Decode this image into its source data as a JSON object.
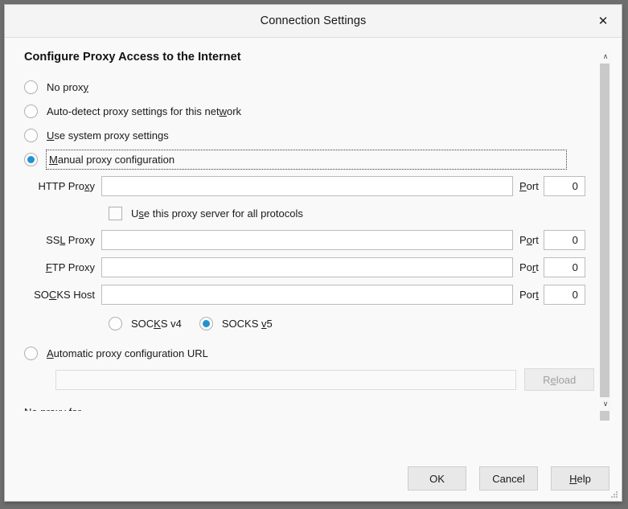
{
  "window": {
    "title": "Connection Settings",
    "close_icon": "close-icon",
    "close_glyph": "✕"
  },
  "section": {
    "title": "Configure Proxy Access to the Internet"
  },
  "proxy_mode": {
    "selected": "manual",
    "options": [
      {
        "id": "no-proxy",
        "label": "No prox",
        "accesskey": "y",
        "label_tail": "",
        "checked": false
      },
      {
        "id": "auto-detect",
        "label": "Auto-detect proxy settings for this net",
        "accesskey": "w",
        "label_tail": "ork",
        "checked": false
      },
      {
        "id": "system",
        "label": "",
        "accesskey": "U",
        "label_tail": "se system proxy settings",
        "checked": false
      },
      {
        "id": "manual",
        "label": "",
        "accesskey": "M",
        "label_tail": "anual proxy configuration",
        "checked": true
      }
    ]
  },
  "fields": {
    "http": {
      "label_head": "HTTP Pro",
      "accesskey": "x",
      "label_tail": "y",
      "value": "",
      "port_head": "",
      "port_accesskey": "P",
      "port_tail": "ort",
      "port_value": "0"
    },
    "share_checkbox": {
      "label_head": "U",
      "accesskey": "s",
      "label_tail": "e this proxy server for all protocols",
      "checked": false
    },
    "ssl": {
      "label_head": "SS",
      "accesskey": "L",
      "label_tail": " Proxy",
      "value": "",
      "port_head": "P",
      "port_accesskey": "o",
      "port_tail": "rt",
      "port_value": "0"
    },
    "ftp": {
      "label_head": "",
      "accesskey": "F",
      "label_tail": "TP Proxy",
      "value": "",
      "port_head": "Po",
      "port_accesskey": "r",
      "port_tail": "t",
      "port_value": "0"
    },
    "socks": {
      "label_head": "SO",
      "accesskey": "C",
      "label_tail": "KS Host",
      "value": "",
      "port_head": "Por",
      "port_accesskey": "t",
      "port_tail": "",
      "port_value": "0"
    }
  },
  "socks_version": {
    "v4": {
      "label_head": "SOC",
      "accesskey": "K",
      "label_tail": "S v4",
      "checked": false
    },
    "v5": {
      "label_head": "SOCKS ",
      "accesskey": "v",
      "label_tail": "5",
      "checked": true
    }
  },
  "pac": {
    "radio_head": "",
    "accesskey": "A",
    "radio_tail": "utomatic proxy configuration URL",
    "checked": false,
    "url_value": "",
    "reload": {
      "head": "R",
      "accesskey": "e",
      "tail": "load",
      "disabled": true
    }
  },
  "no_proxy_for": {
    "label_head": "",
    "accesskey": "N",
    "label_tail": "o proxy for",
    "value": ""
  },
  "footer": {
    "ok": {
      "head": "OK",
      "accesskey": "",
      "tail": ""
    },
    "cancel": {
      "head": "Cancel",
      "accesskey": "",
      "tail": ""
    },
    "help": {
      "head": "",
      "accesskey": "H",
      "tail": "elp"
    }
  },
  "scrollbar": {
    "up_glyph": "∧",
    "down_glyph": "∨"
  },
  "colors": {
    "accent": "#2292d0",
    "window_bg": "#f9f9f9",
    "titlebar_bg": "#f4f4f4",
    "border": "#bcbcbc"
  }
}
